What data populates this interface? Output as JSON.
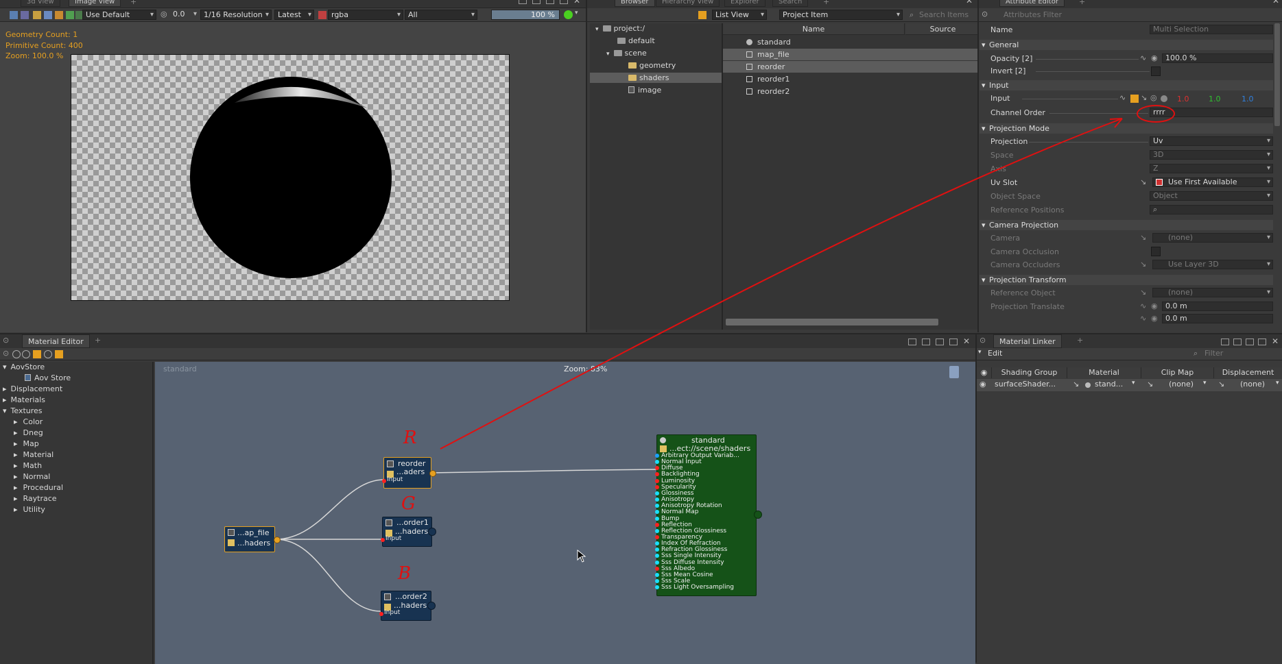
{
  "viewer": {
    "tabs": [
      "3d View",
      "Image View"
    ],
    "display_mode": "Use Default",
    "exposure": "0.0",
    "resolution": "1/16 Resolution",
    "version": "Latest",
    "channels": "rgba",
    "layer": "All",
    "zoom_percent": "100 %",
    "stats": {
      "geometry": "Geometry Count: 1",
      "primitive": "Primitive Count: 400",
      "zoom": "Zoom: 100.0 %"
    }
  },
  "browser": {
    "tabs": [
      "Browser",
      "Hierarchy View",
      "Explorer",
      "Search"
    ],
    "view_mode": "List View",
    "filter": "Project Item",
    "search_placeholder": "Search Items",
    "tree": [
      {
        "label": "project:/",
        "indent": 0,
        "expanded": true
      },
      {
        "label": "default",
        "indent": 1
      },
      {
        "label": "scene",
        "indent": 1,
        "expanded": true
      },
      {
        "label": "geometry",
        "indent": 2
      },
      {
        "label": "shaders",
        "indent": 2,
        "selected": true
      },
      {
        "label": "image",
        "indent": 2
      }
    ],
    "columns": [
      "Name",
      "Source"
    ],
    "items": [
      {
        "name": "standard",
        "selected": false
      },
      {
        "name": "map_file",
        "selected": true
      },
      {
        "name": "reorder",
        "selected": true
      },
      {
        "name": "reorder1",
        "selected": false
      },
      {
        "name": "reorder2",
        "selected": false
      }
    ]
  },
  "attribute_editor": {
    "tab": "Attribute Editor",
    "filter_placeholder": "Attributes Filter",
    "name_label": "Name",
    "name_value": "Multi Selection",
    "sections": {
      "general": "General",
      "input": "Input",
      "projection_mode": "Projection Mode",
      "camera_projection": "Camera Projection",
      "projection_transform": "Projection Transform"
    },
    "opacity_label": "Opacity [2]",
    "opacity_value": "100.0 %",
    "invert_label": "Invert [2]",
    "input_label": "Input",
    "input_r": "1.0",
    "input_g": "1.0",
    "input_b": "1.0",
    "channel_order_label": "Channel Order",
    "channel_order_value": "rrrr",
    "projection_label": "Projection",
    "projection_value": "Uv",
    "space_label": "Space",
    "space_value": "3D",
    "axis_label": "Axis",
    "axis_value": "Z",
    "uv_slot_label": "Uv Slot",
    "uv_slot_value": "Use First Available",
    "object_space_label": "Object Space",
    "object_space_value": "Object",
    "reference_positions_label": "Reference Positions",
    "camera_label": "Camera",
    "camera_value": "(none)",
    "camera_occlusion_label": "Camera Occlusion",
    "camera_occluders_label": "Camera Occluders",
    "camera_occluders_value": "Use Layer 3D",
    "reference_object_label": "Reference Object",
    "reference_object_value": "(none)",
    "projection_translate_label": "Projection Translate",
    "translate_x": "0.0 m",
    "translate_y": "0.0 m"
  },
  "material_editor": {
    "tab": "Material Editor",
    "canvas_title": "standard",
    "zoom": "Zoom: 83%",
    "library": [
      {
        "label": "AovStore",
        "indent": 0,
        "arrow": "▾"
      },
      {
        "label": "Aov Store",
        "indent": 2,
        "arrow": ""
      },
      {
        "label": "Displacement",
        "indent": 0,
        "arrow": "▸"
      },
      {
        "label": "Materials",
        "indent": 0,
        "arrow": "▸"
      },
      {
        "label": "Textures",
        "indent": 0,
        "arrow": "▾"
      },
      {
        "label": "Color",
        "indent": 1,
        "arrow": "▸"
      },
      {
        "label": "Dneg",
        "indent": 1,
        "arrow": "▸"
      },
      {
        "label": "Map",
        "indent": 1,
        "arrow": "▸"
      },
      {
        "label": "Material",
        "indent": 1,
        "arrow": "▸"
      },
      {
        "label": "Math",
        "indent": 1,
        "arrow": "▸"
      },
      {
        "label": "Normal",
        "indent": 1,
        "arrow": "▸"
      },
      {
        "label": "Procedural",
        "indent": 1,
        "arrow": "▸"
      },
      {
        "label": "Raytrace",
        "indent": 1,
        "arrow": "▸"
      },
      {
        "label": "Utility",
        "indent": 1,
        "arrow": "▸"
      }
    ],
    "nodes": {
      "map_file": {
        "title": "...ap_file",
        "sub": "...haders"
      },
      "reorder": {
        "title": "reorder",
        "sub": "...aders",
        "port": "Input"
      },
      "reorder1": {
        "title": "...order1",
        "sub": "...haders",
        "port": "Input"
      },
      "reorder2": {
        "title": "...order2",
        "sub": "...haders",
        "port": "Input"
      },
      "standard": {
        "title": "standard",
        "sub": "...ect://scene/shaders",
        "ports": [
          {
            "label": "Arbitrary Output Variab...",
            "color": "#1aa0ff"
          },
          {
            "label": "Normal Input",
            "color": "#1ae0ff"
          },
          {
            "label": "Diffuse",
            "color": "#ff2020"
          },
          {
            "label": "Backlighting",
            "color": "#ff2020"
          },
          {
            "label": "Luminosity",
            "color": "#ff2020"
          },
          {
            "label": "Specularity",
            "color": "#ff2020"
          },
          {
            "label": "Glossiness",
            "color": "#1ae0ff"
          },
          {
            "label": "Anisotropy",
            "color": "#1ae0ff"
          },
          {
            "label": "Anisotropy Rotation",
            "color": "#1ae0ff"
          },
          {
            "label": "Normal Map",
            "color": "#1ae0ff"
          },
          {
            "label": "Bump",
            "color": "#1ae0ff"
          },
          {
            "label": "Reflection",
            "color": "#ff2020"
          },
          {
            "label": "Reflection Glossiness",
            "color": "#1ae0ff"
          },
          {
            "label": "Transparency",
            "color": "#ff2020"
          },
          {
            "label": "Index Of Refraction",
            "color": "#1ae0ff"
          },
          {
            "label": "Refraction Glossiness",
            "color": "#1ae0ff"
          },
          {
            "label": "Sss Single Intensity",
            "color": "#1ae0ff"
          },
          {
            "label": "Sss Diffuse Intensity",
            "color": "#1ae0ff"
          },
          {
            "label": "Sss Albedo",
            "color": "#ff2020"
          },
          {
            "label": "Sss Mean Cosine",
            "color": "#1ae0ff"
          },
          {
            "label": "Sss Scale",
            "color": "#1ae0ff"
          },
          {
            "label": "Sss Light Oversampling",
            "color": "#1ae0ff"
          }
        ]
      }
    },
    "annotations": {
      "r": "R",
      "g": "G",
      "b": "B"
    }
  },
  "material_linker": {
    "tab": "Material Linker",
    "edit_label": "Edit",
    "filter_placeholder": "Filter",
    "columns": [
      "Shading Group",
      "Material",
      "Clip Map",
      "Displacement"
    ],
    "row": {
      "shading_group": "surfaceShader...",
      "material": "stand...",
      "clip_map": "(none)",
      "displacement": "(none)"
    }
  },
  "colors": {
    "accent_orange": "#e6a020",
    "annotation_red": "#e01010",
    "node_blue": "#183351",
    "node_green": "#155218",
    "selection_gray": "#5c5c5c"
  }
}
